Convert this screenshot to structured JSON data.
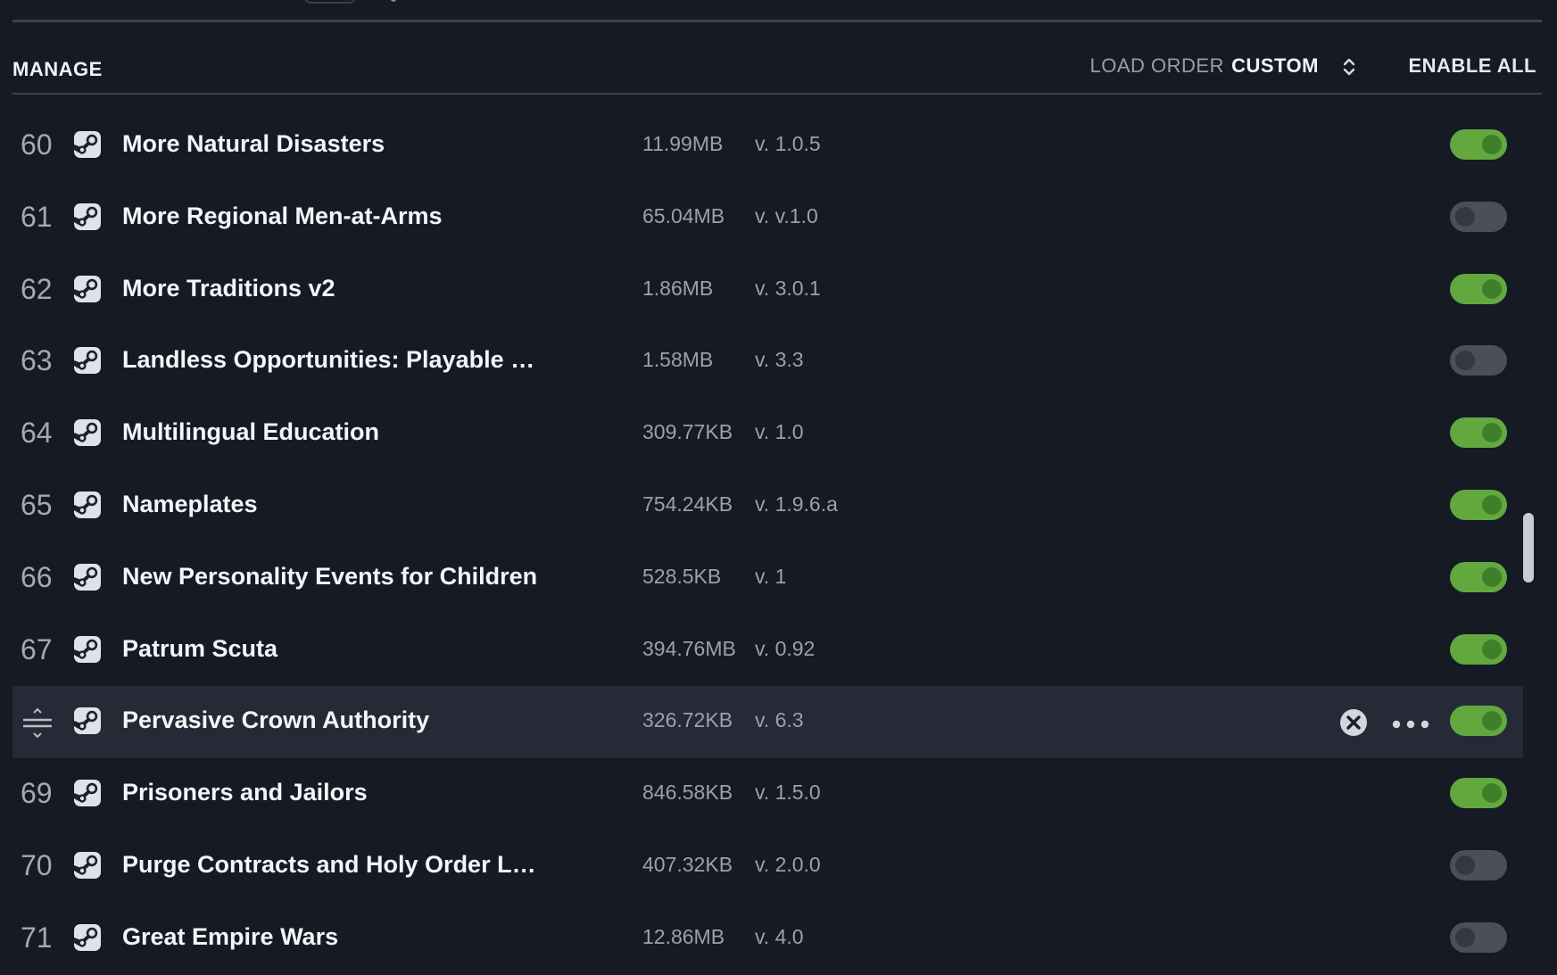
{
  "header": {
    "title": "MANAGE",
    "load_order_label": "LOAD ORDER",
    "load_order_value": "CUSTOM",
    "enable_all_label": "ENABLE ALL"
  },
  "colors": {
    "toggle_on": "#62a83f",
    "toggle_off": "#4b4f59",
    "background": "#161a25"
  },
  "mods": [
    {
      "index": "60",
      "name": "More Natural Disasters",
      "size": "11.99MB",
      "version": "v. 1.0.5",
      "enabled": true
    },
    {
      "index": "61",
      "name": "More Regional Men-at-Arms",
      "size": "65.04MB",
      "version": "v. v.1.0",
      "enabled": false
    },
    {
      "index": "62",
      "name": "More Traditions v2",
      "size": "1.86MB",
      "version": "v. 3.0.1",
      "enabled": true
    },
    {
      "index": "63",
      "name": "Landless Opportunities: Playable …",
      "size": "1.58MB",
      "version": "v. 3.3",
      "enabled": false
    },
    {
      "index": "64",
      "name": "Multilingual Education",
      "size": "309.77KB",
      "version": "v. 1.0",
      "enabled": true
    },
    {
      "index": "65",
      "name": "Nameplates",
      "size": "754.24KB",
      "version": "v. 1.9.6.a",
      "enabled": true
    },
    {
      "index": "66",
      "name": "New Personality Events for Children",
      "size": "528.5KB",
      "version": "v. 1",
      "enabled": true
    },
    {
      "index": "67",
      "name": "Patrum Scuta",
      "size": "394.76MB",
      "version": "v. 0.92",
      "enabled": true
    },
    {
      "index": "",
      "name": "Pervasive Crown Authority",
      "size": "326.72KB",
      "version": "v. 6.3",
      "enabled": true,
      "selected": true
    },
    {
      "index": "69",
      "name": "Prisoners and Jailors",
      "size": "846.58KB",
      "version": "v. 1.5.0",
      "enabled": true
    },
    {
      "index": "70",
      "name": "Purge Contracts and Holy Order L…",
      "size": "407.32KB",
      "version": "v. 2.0.0",
      "enabled": false
    },
    {
      "index": "71",
      "name": "Great Empire Wars",
      "size": "12.86MB",
      "version": "v. 4.0",
      "enabled": false
    }
  ],
  "icons": {
    "source": "steam-icon",
    "handle": "drag-handle-icon",
    "remove": "close-circle-icon",
    "more": "more-horizontal-icon",
    "sort": "sort-updown-icon"
  }
}
